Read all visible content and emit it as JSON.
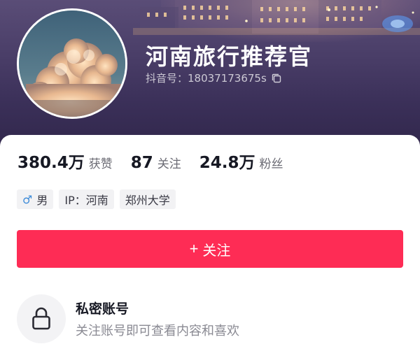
{
  "profile": {
    "name": "河南旅行推荐官",
    "douyin_id": "抖音号：18037173675s",
    "avatar_icon": "cloud-sky-avatar",
    "copy_icon": "copy-icon"
  },
  "stats": [
    {
      "value": "380.4万",
      "label": "获赞"
    },
    {
      "value": "87",
      "label": "关注"
    },
    {
      "value": "24.8万",
      "label": "粉丝"
    }
  ],
  "tags": {
    "gender_icon": "♂",
    "gender": "男",
    "ip": "IP：河南",
    "school": "郑州大学"
  },
  "follow_button": {
    "icon": "+",
    "label": "关注"
  },
  "private_account": {
    "icon": "lock-icon",
    "title": "私密账号",
    "description": "关注账号即可查看内容和喜欢"
  },
  "colors": {
    "accent": "#fe2c55",
    "banner": "#3b3059",
    "gender_blue": "#3d8bd8"
  }
}
